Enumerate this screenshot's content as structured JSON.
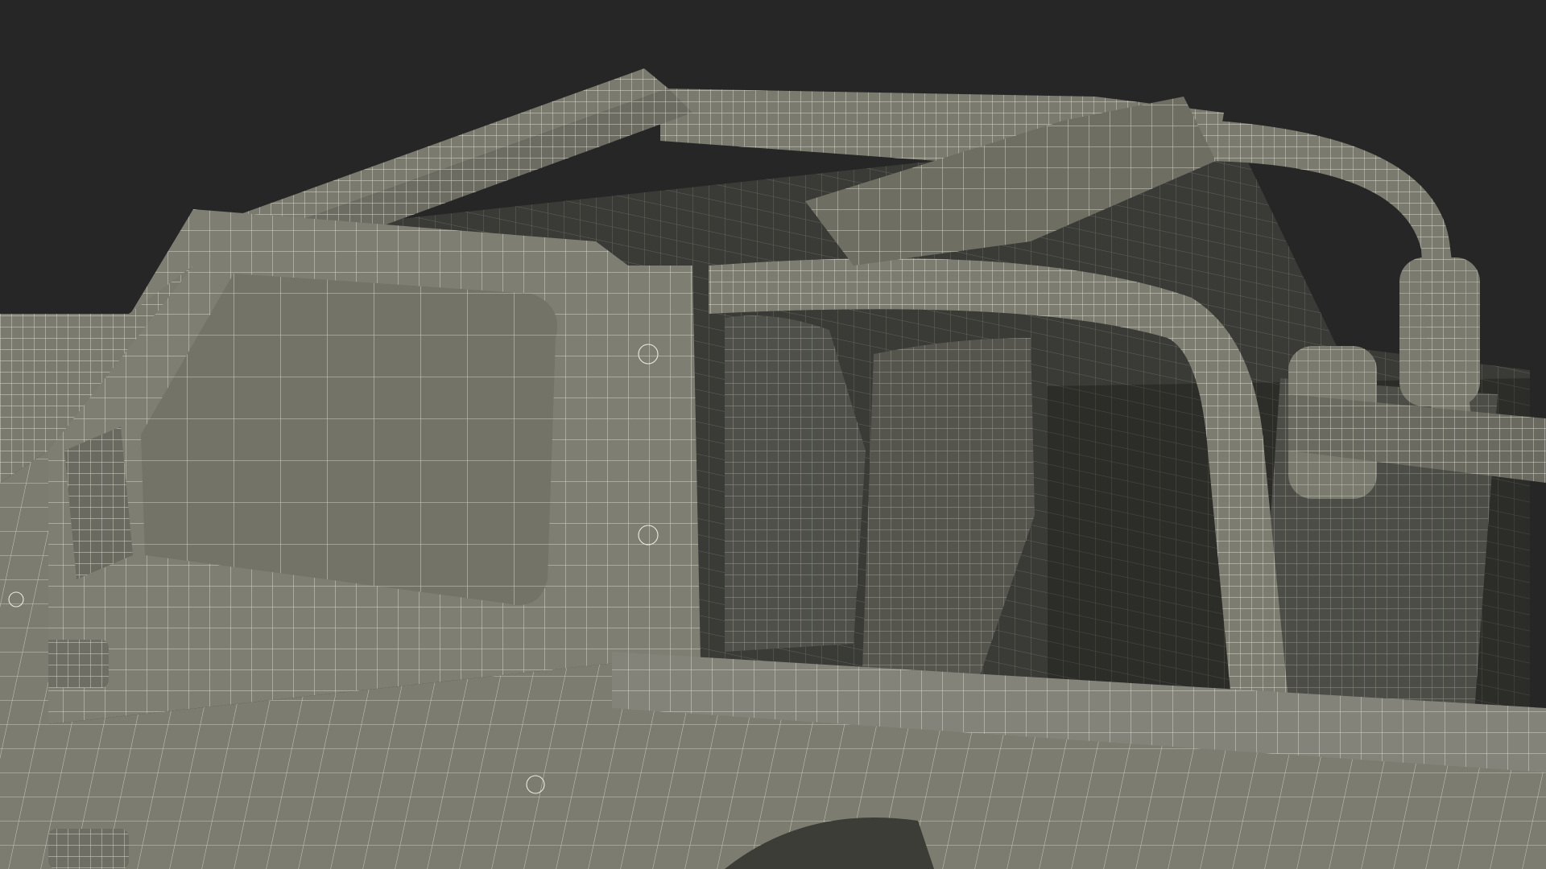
{
  "scene": {
    "subject": "wireframe-render-of-open-top-offroad-vehicle",
    "colors": {
      "background": "#262626",
      "surface": "#76766a",
      "surface_light": "#8a8a7e",
      "surface_dark": "#5b5b52",
      "interior": "#3a3a36",
      "interior_deep": "#2c2c29",
      "wire": "#ecebdf"
    }
  }
}
